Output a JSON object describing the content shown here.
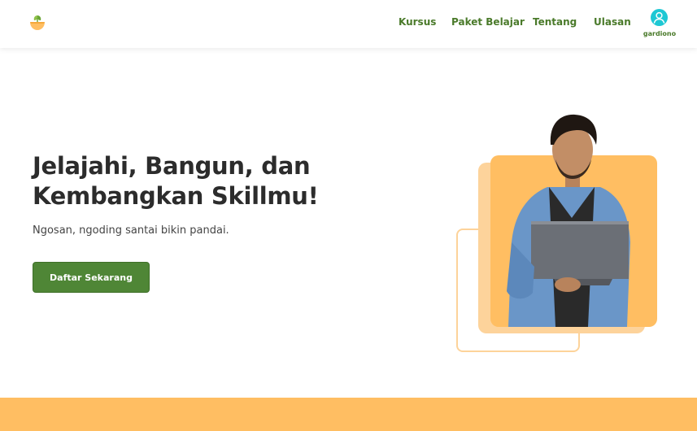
{
  "nav": {
    "links": [
      "Kursus",
      "Paket Belajar",
      "Tentang",
      "Ulasan"
    ],
    "user_name": "gardiono",
    "logo_icon": "sprout-bowl-icon",
    "avatar_icon": "user-avatar-icon"
  },
  "hero": {
    "title_line1": "Jelajahi, Bangun, dan",
    "title_line2": "Kembangkan Skillmu!",
    "subtitle": "Ngosan, ngoding santai bikin pandai.",
    "cta_label": "Daftar Sekarang"
  },
  "colors": {
    "brand_green": "#4f8636",
    "accent_orange": "#ffbe62",
    "accent_light": "#fdd39b",
    "avatar_cyan": "#1ec8d4"
  }
}
